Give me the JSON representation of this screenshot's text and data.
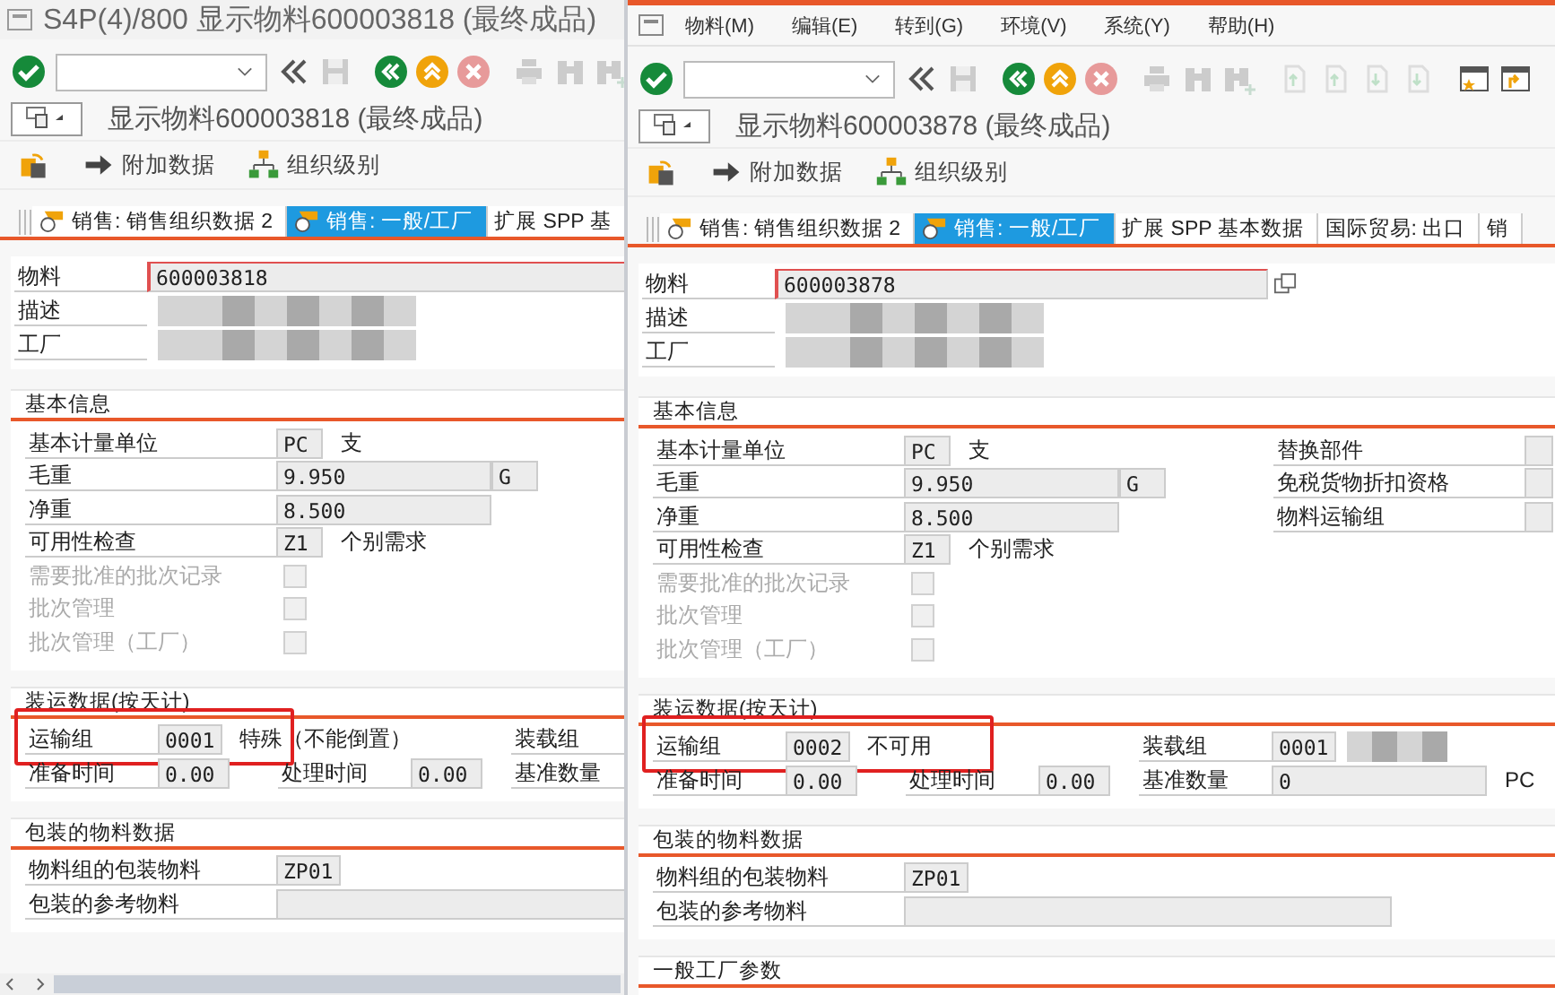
{
  "windows": [
    {
      "title_bar": "S4P(4)/800 显示物料600003818 (最终成品)",
      "screen_title": "显示物料600003818 (最终成品)",
      "horizontal_scrollbar": true,
      "app_toolbar": [
        {
          "kind": "switch"
        },
        {
          "kind": "arrow",
          "label": "附加数据"
        },
        {
          "kind": "org",
          "label": "组织级别"
        }
      ],
      "tabs": [
        {
          "label": "销售: 销售组织数据 2",
          "selected": false
        },
        {
          "label": "销售: 一般/工厂",
          "selected": true
        },
        {
          "label": "扩展 SPP 基",
          "selected": false
        }
      ],
      "header": [
        {
          "label": "物料",
          "value": "600003818",
          "redacted": false
        },
        {
          "label": "描述",
          "redacted": true
        },
        {
          "label": "工厂",
          "redacted": true
        }
      ],
      "sections": [
        {
          "title": "基本信息",
          "kind": "basic",
          "rows": [
            {
              "groups": [
                [
                  {
                    "kind": "label",
                    "text": "基本计量单位"
                  },
                  {
                    "kind": "code",
                    "text": "PC"
                  },
                  {
                    "kind": "text",
                    "text": "支"
                  }
                ]
              ]
            },
            {
              "groups": [
                [
                  {
                    "kind": "label",
                    "text": "毛重"
                  },
                  {
                    "kind": "amount",
                    "text": "9.950"
                  },
                  {
                    "kind": "unit",
                    "text": "G"
                  }
                ]
              ]
            },
            {
              "groups": [
                [
                  {
                    "kind": "label",
                    "text": "净重"
                  },
                  {
                    "kind": "amount",
                    "text": "8.500"
                  }
                ]
              ]
            },
            {
              "groups": [
                [
                  {
                    "kind": "label",
                    "text": "可用性检查"
                  },
                  {
                    "kind": "code",
                    "text": "Z1"
                  },
                  {
                    "kind": "text",
                    "text": "个别需求"
                  }
                ]
              ]
            },
            {
              "groups": [
                [
                  {
                    "kind": "label",
                    "text": "需要批准的批次记录",
                    "disabled": true
                  },
                  {
                    "kind": "check",
                    "checked": false,
                    "disabled": true
                  }
                ]
              ]
            },
            {
              "groups": [
                [
                  {
                    "kind": "label",
                    "text": "批次管理",
                    "disabled": true
                  },
                  {
                    "kind": "check",
                    "checked": false,
                    "disabled": true
                  }
                ]
              ]
            },
            {
              "groups": [
                [
                  {
                    "kind": "label",
                    "text": "批次管理（工厂）",
                    "disabled": true
                  },
                  {
                    "kind": "check",
                    "checked": false,
                    "disabled": true
                  }
                ]
              ]
            }
          ]
        },
        {
          "title": "装运数据(按天计)",
          "kind": "shipping",
          "rows": [
            {
              "highlight": true,
              "groups": [
                [
                  {
                    "kind": "label",
                    "text": "运输组"
                  },
                  {
                    "kind": "code",
                    "text": "0001"
                  },
                  {
                    "kind": "text",
                    "text": "特殊（不能倒置）"
                  }
                ],
                [
                  {
                    "kind": "label",
                    "text": "装载组"
                  }
                ]
              ]
            },
            {
              "groups": [
                [
                  {
                    "kind": "label",
                    "text": "准备时间"
                  },
                  {
                    "kind": "time",
                    "text": "0.00"
                  }
                ],
                [
                  {
                    "kind": "label",
                    "text": "处理时间"
                  },
                  {
                    "kind": "time",
                    "text": "0.00"
                  }
                ],
                [
                  {
                    "kind": "label",
                    "text": "基准数量"
                  }
                ]
              ]
            }
          ]
        },
        {
          "title": "包装的物料数据",
          "kind": "packaging",
          "rows": [
            {
              "groups": [
                [
                  {
                    "kind": "label",
                    "text": "物料组的包装物料"
                  },
                  {
                    "kind": "code",
                    "text": "ZP01"
                  }
                ]
              ]
            },
            {
              "groups": [
                [
                  {
                    "kind": "label",
                    "text": "包装的参考物料"
                  },
                  {
                    "kind": "long"
                  }
                ]
              ]
            }
          ]
        }
      ]
    },
    {
      "menu": [
        {
          "label": "物料(M)"
        },
        {
          "label": "编辑(E)"
        },
        {
          "label": "转到(G)"
        },
        {
          "label": "环境(V)"
        },
        {
          "label": "系统(Y)"
        },
        {
          "label": "帮助(H)"
        }
      ],
      "screen_title": "显示物料600003878 (最终成品)",
      "app_toolbar": [
        {
          "kind": "switch"
        },
        {
          "kind": "arrow",
          "label": "附加数据"
        },
        {
          "kind": "org",
          "label": "组织级别"
        }
      ],
      "tabs": [
        {
          "label": "销售: 销售组织数据 2",
          "selected": false
        },
        {
          "label": "销售: 一般/工厂",
          "selected": true
        },
        {
          "label": "扩展 SPP 基本数据",
          "selected": false
        },
        {
          "label": "国际贸易: 出口",
          "selected": false
        },
        {
          "label": "销",
          "selected": false
        }
      ],
      "header": [
        {
          "label": "物料",
          "value": "600003878",
          "redacted": false
        },
        {
          "label": "描述",
          "redacted": true
        },
        {
          "label": "工厂",
          "redacted": true
        }
      ],
      "sections": [
        {
          "title": "基本信息",
          "kind": "basic",
          "rows": [
            {
              "groups": [
                [
                  {
                    "kind": "label",
                    "text": "基本计量单位"
                  },
                  {
                    "kind": "code",
                    "text": "PC"
                  },
                  {
                    "kind": "text",
                    "text": "支"
                  }
                ],
                [
                  {
                    "kind": "label",
                    "text": "替换部件"
                  },
                  {
                    "kind": "edge"
                  }
                ]
              ]
            },
            {
              "groups": [
                [
                  {
                    "kind": "label",
                    "text": "毛重"
                  },
                  {
                    "kind": "amount",
                    "text": "9.950"
                  },
                  {
                    "kind": "unit",
                    "text": "G"
                  }
                ],
                [
                  {
                    "kind": "label",
                    "text": "免税货物折扣资格"
                  },
                  {
                    "kind": "edge"
                  }
                ]
              ]
            },
            {
              "groups": [
                [
                  {
                    "kind": "label",
                    "text": "净重"
                  },
                  {
                    "kind": "amount",
                    "text": "8.500"
                  }
                ],
                [
                  {
                    "kind": "label",
                    "text": "物料运输组"
                  },
                  {
                    "kind": "edge"
                  }
                ]
              ]
            },
            {
              "groups": [
                [
                  {
                    "kind": "label",
                    "text": "可用性检查"
                  },
                  {
                    "kind": "code",
                    "text": "Z1"
                  },
                  {
                    "kind": "text",
                    "text": "个别需求"
                  }
                ]
              ]
            },
            {
              "groups": [
                [
                  {
                    "kind": "label",
                    "text": "需要批准的批次记录",
                    "disabled": true
                  },
                  {
                    "kind": "check",
                    "checked": false,
                    "disabled": true
                  }
                ]
              ]
            },
            {
              "groups": [
                [
                  {
                    "kind": "label",
                    "text": "批次管理",
                    "disabled": true
                  },
                  {
                    "kind": "check",
                    "checked": false,
                    "disabled": true
                  }
                ]
              ]
            },
            {
              "groups": [
                [
                  {
                    "kind": "label",
                    "text": "批次管理（工厂）",
                    "disabled": true
                  },
                  {
                    "kind": "check",
                    "checked": false,
                    "disabled": true
                  }
                ]
              ]
            }
          ]
        },
        {
          "title": "装运数据(按天计)",
          "kind": "shipping",
          "rows": [
            {
              "highlight": true,
              "groups": [
                [
                  {
                    "kind": "label",
                    "text": "运输组"
                  },
                  {
                    "kind": "code",
                    "text": "0002"
                  },
                  {
                    "kind": "text",
                    "text": "不可用"
                  }
                ],
                [
                  {
                    "kind": "label",
                    "text": "装载组"
                  },
                  {
                    "kind": "code",
                    "text": "0001"
                  },
                  {
                    "kind": "blur"
                  }
                ]
              ]
            },
            {
              "groups": [
                [
                  {
                    "kind": "label",
                    "text": "准备时间"
                  },
                  {
                    "kind": "time",
                    "text": "0.00"
                  }
                ],
                [
                  {
                    "kind": "label",
                    "text": "处理时间"
                  },
                  {
                    "kind": "time",
                    "text": "0.00"
                  }
                ],
                [
                  {
                    "kind": "label",
                    "text": "基准数量"
                  },
                  {
                    "kind": "qty",
                    "text": "0"
                  },
                  {
                    "kind": "text",
                    "text": "PC"
                  }
                ]
              ]
            }
          ]
        },
        {
          "title": "包装的物料数据",
          "kind": "packaging",
          "rows": [
            {
              "groups": [
                [
                  {
                    "kind": "label",
                    "text": "物料组的包装物料"
                  },
                  {
                    "kind": "code",
                    "text": "ZP01"
                  }
                ]
              ]
            },
            {
              "groups": [
                [
                  {
                    "kind": "label",
                    "text": "包装的参考物料"
                  },
                  {
                    "kind": "long"
                  }
                ]
              ]
            }
          ]
        },
        {
          "title": "一般工厂参数",
          "kind": "packaging"
        }
      ]
    }
  ]
}
